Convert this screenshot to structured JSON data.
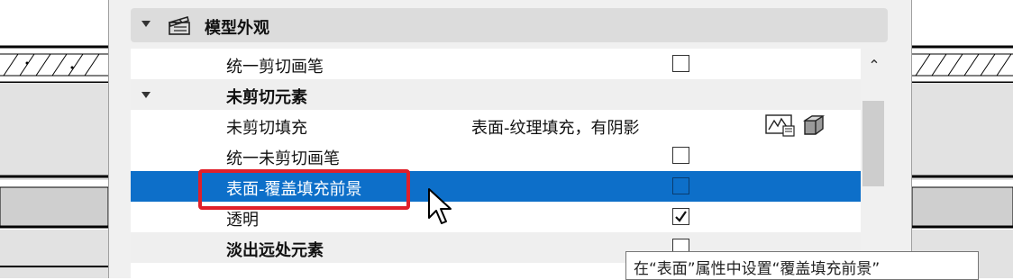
{
  "panel": {
    "group_title": "模型外观",
    "group_icon": "clapperboard-icon"
  },
  "rows": [
    {
      "label": "统一剪切画笔",
      "checked": false
    },
    {
      "label": "未剪切元素"
    },
    {
      "label": "未剪切填充",
      "value": "表面-纹理填充，有阴影"
    },
    {
      "label": "统一未剪切画笔",
      "checked": false
    },
    {
      "label": "表面-覆盖填充前景",
      "checked": false
    },
    {
      "label": "透明",
      "checked": true
    },
    {
      "label": "淡出远处元素",
      "checked": false
    }
  ],
  "tooltip": {
    "text": "在“表面”属性中设置“覆盖填充前景”"
  },
  "colors": {
    "selection": "#0d6fc9",
    "highlight": "#e0202a"
  }
}
